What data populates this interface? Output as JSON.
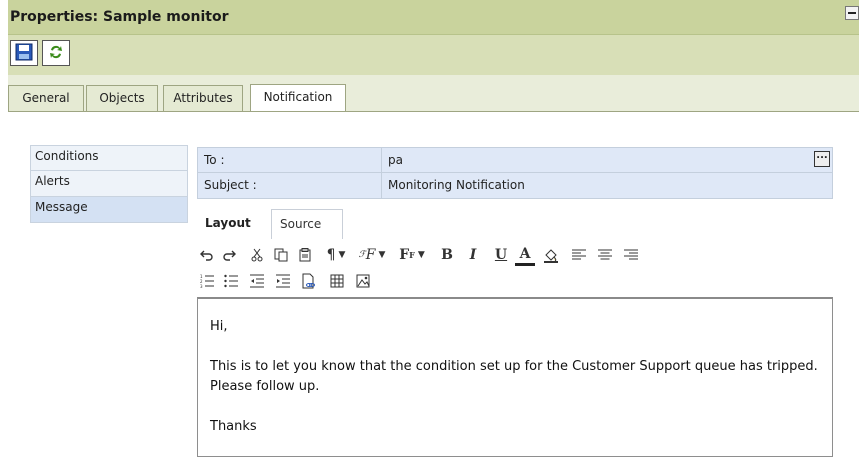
{
  "window": {
    "title": "Properties: Sample monitor"
  },
  "toolbar": {
    "save_icon": "save-icon",
    "refresh_icon": "refresh-icon"
  },
  "tabs": [
    {
      "label": "General"
    },
    {
      "label": "Objects"
    },
    {
      "label": "Attributes"
    },
    {
      "label": "Notification",
      "active": true
    }
  ],
  "sidenav": [
    {
      "label": "Conditions"
    },
    {
      "label": "Alerts"
    },
    {
      "label": "Message",
      "active": true
    }
  ],
  "fields": {
    "to_label": "To :",
    "to_value": "pa",
    "to_button": "...",
    "subject_label": "Subject :",
    "subject_value": "Monitoring Notification"
  },
  "editor_tabs": {
    "layout": "Layout",
    "source": "Source"
  },
  "editor_toolbar": {
    "row1": [
      "undo-icon",
      "redo-icon",
      "cut-icon",
      "copy-icon",
      "paste-icon",
      "paragraph-format-icon",
      "font-family-icon",
      "font-size-icon",
      "bold-icon",
      "italic-icon",
      "underline-icon",
      "font-color-icon",
      "highlight-color-icon",
      "align-left-icon",
      "align-center-icon",
      "align-right-icon"
    ],
    "row2": [
      "numbered-list-icon",
      "bullet-list-icon",
      "outdent-icon",
      "indent-icon",
      "insert-link-icon",
      "insert-table-icon",
      "insert-image-icon"
    ],
    "labels": {
      "paragraph": "¶",
      "font_family": "F",
      "font_size": "F",
      "bold": "B",
      "italic": "I",
      "underline": "U",
      "font_color": "A"
    }
  },
  "message": {
    "line1": "Hi,",
    "line2": "This is to let you know that the condition set up for the Customer Support queue has tripped. Please follow up.",
    "line3": "Thanks"
  }
}
